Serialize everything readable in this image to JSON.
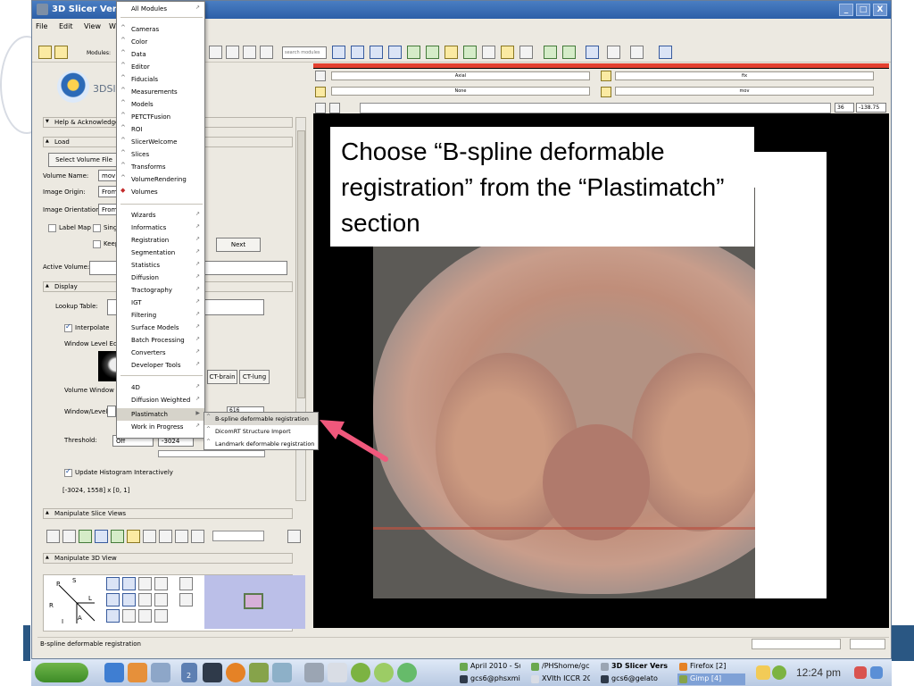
{
  "window": {
    "title": "3D Slicer Version",
    "menus": [
      "File",
      "Edit",
      "View",
      "W"
    ],
    "controls": [
      "_",
      "□",
      "X"
    ]
  },
  "toolbar": {
    "modules_label": "Modules:",
    "search_placeholder": "search modules"
  },
  "left_panel": {
    "logo_text": "3DSlic",
    "help_section": "Help & Acknowledgeme",
    "load_section": "Load",
    "select_volume_button": "Select Volume File",
    "volume_name_label": "Volume Name:",
    "volume_name_value": "mov",
    "image_origin_label": "Image Origin:",
    "image_origin_value": "From",
    "image_orientation_label": "Image Orientation:",
    "image_orientation_value": "From",
    "label_map": "Label Map",
    "single": "Singl",
    "keep": "Keep",
    "next_button": "Next",
    "active_volume_label": "Active Volume:",
    "display_section": "Display",
    "lookup_table_label": "Lookup Table:",
    "interpolate": "Interpolate",
    "window_level_editor": "Window Level Edit",
    "ct_brain": "CT-brain",
    "ct_lung": "CT-lung",
    "volume_window_label": "Volume Window Le",
    "window_level_label": "Window/Level:",
    "window_level_value": "616",
    "threshold_label": "Threshold:",
    "threshold_mode": "Off",
    "threshold_value": "-3024",
    "update_histogram": "Update Histogram Interactively",
    "histogram_range": "[-3024, 1558] x [0, 1]",
    "manipulate_slice_views": "Manipulate Slice Views",
    "manipulate_3d_view": "Manipulate 3D View",
    "axis_labels": [
      "P",
      "S",
      "L",
      "R",
      "I",
      "A"
    ]
  },
  "menu": {
    "top_items": [
      {
        "label": "All Modules",
        "arrow": true
      },
      {
        "label": "Cameras"
      },
      {
        "label": "Color"
      },
      {
        "label": "Data"
      },
      {
        "label": "Editor"
      },
      {
        "label": "Fiducials"
      },
      {
        "label": "Measurements"
      },
      {
        "label": "Models"
      },
      {
        "label": "PETCTFusion"
      },
      {
        "label": "ROI"
      },
      {
        "label": "SlicerWelcome"
      },
      {
        "label": "Slices"
      },
      {
        "label": "Transforms"
      },
      {
        "label": "VolumeRendering"
      },
      {
        "label": "Volumes",
        "selected": true
      }
    ],
    "category_items": [
      "Wizards",
      "Informatics",
      "Registration",
      "Segmentation",
      "Statistics",
      "Diffusion",
      "Tractography",
      "IGT",
      "Filtering",
      "Surface Models",
      "Batch Processing",
      "Converters",
      "Developer Tools"
    ],
    "bottom_items": [
      "4D",
      "Diffusion Weighted",
      "Plastimatch",
      "Work in Progress"
    ],
    "active_item": "Plastimatch",
    "submenu": [
      "B-spline deformable registration",
      "DicomRT Structure Import",
      "Landmark deformable registration"
    ]
  },
  "viewer": {
    "orientation": "Axial",
    "background_layer": "None",
    "foreground_layer": "fix",
    "label_layer": "mov",
    "slice_index": "36",
    "slice_offset": "-138.75",
    "caption": "Choose “B-spline deformable registration” from the “Plastimatch” section"
  },
  "status_bar": {
    "message": "B-spline deformable registration"
  },
  "taskbar": {
    "workspace_number": "2",
    "tasks": [
      {
        "label": "April 2010 - Su"
      },
      {
        "label": "gcs6@phsxmi"
      },
      {
        "label": "/PHShome/gc"
      },
      {
        "label": "XVIth ICCR 20"
      },
      {
        "label": "3D Slicer Vers"
      },
      {
        "label": "gcs6@gelato"
      },
      {
        "label": "Firefox [2]"
      },
      {
        "label": "Gimp [4]"
      }
    ],
    "clock": "12:24 pm"
  },
  "colors": {
    "titlebar": "#2c5fa8",
    "viewer_highlight": "#e3402f",
    "pointer_arrow": "#f0587c"
  }
}
